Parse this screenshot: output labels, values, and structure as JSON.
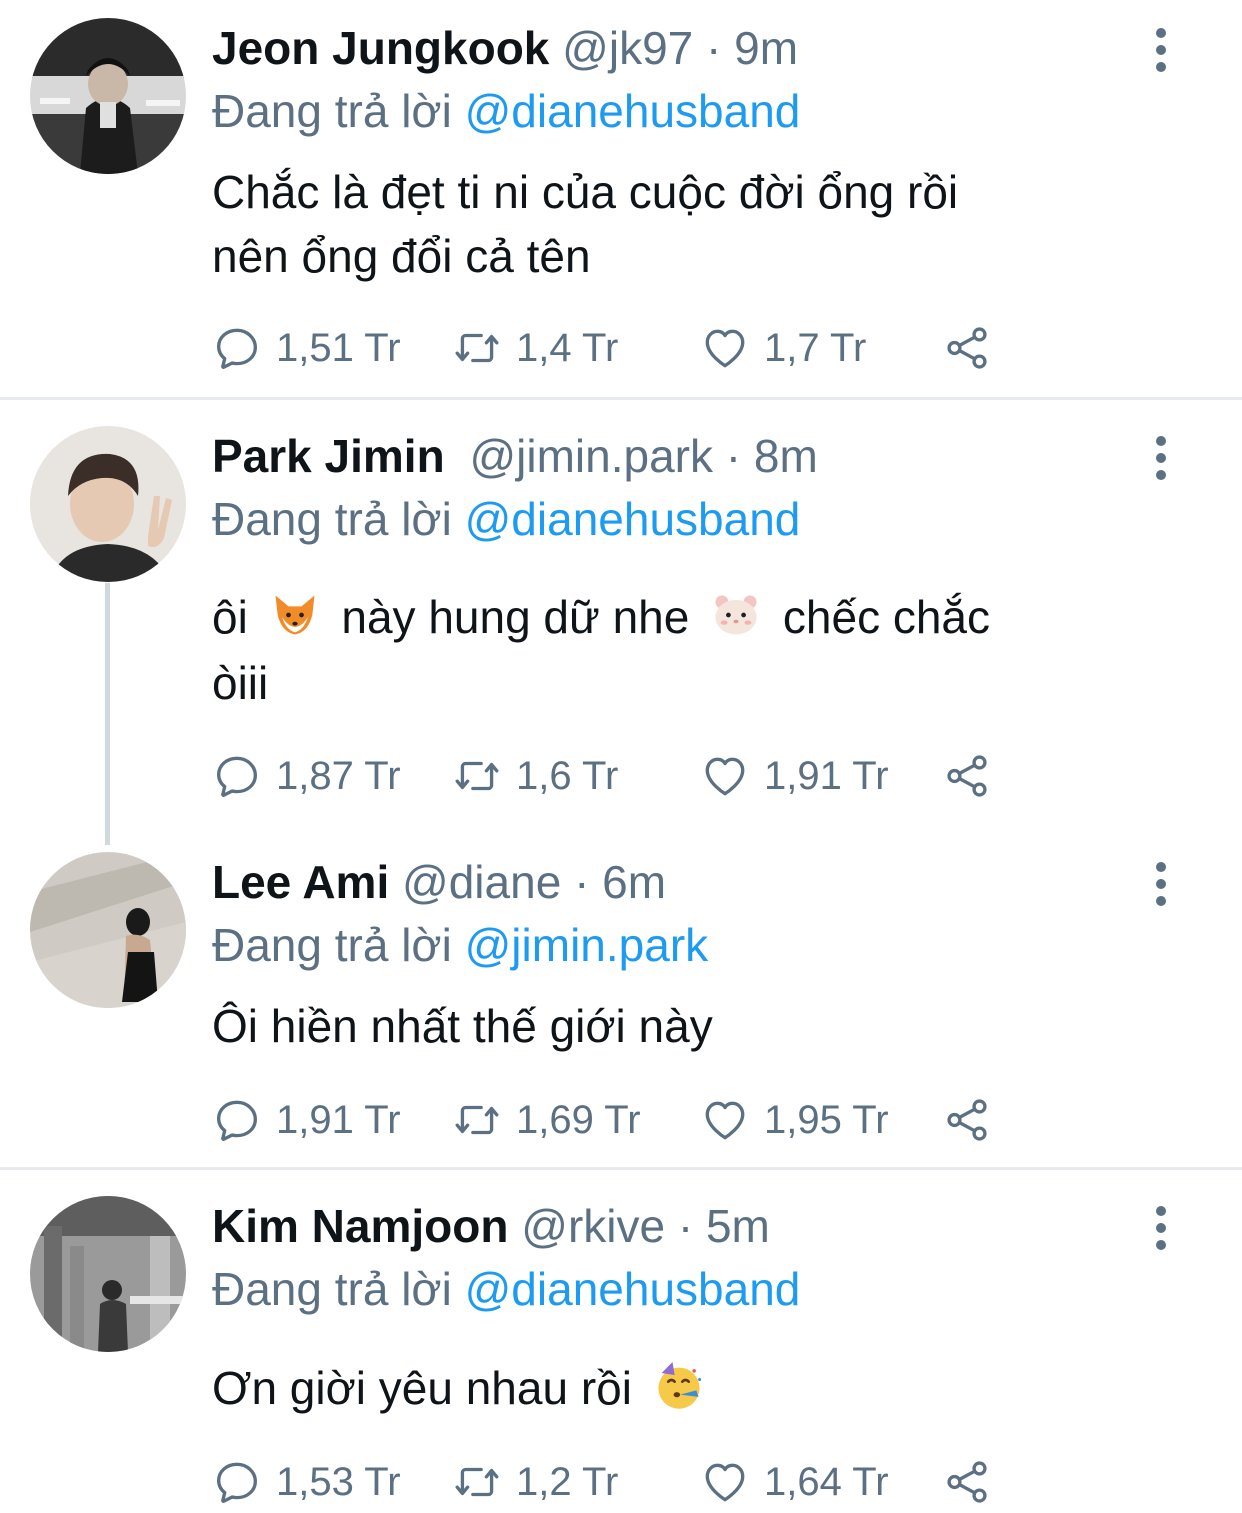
{
  "reply_prefix": "Đang trả lời",
  "colors": {
    "name": "#0f1419",
    "secondary": "#5b7083",
    "link": "#1d9bf0",
    "divider": "#e7eaed",
    "thread_line": "#cfd9de"
  },
  "tweets": [
    {
      "display_name": "Jeon Jungkook",
      "handle": "@jk97",
      "separator": "·",
      "time": "9m",
      "reply_to": "@dianehusband",
      "text_lines": [
        "Chắc là đẹt ti ni của cuộc đời ổng rồi",
        "nên ổng đổi cả tên"
      ],
      "stats": {
        "replies": "1,51 Tr",
        "retweets": "1,4 Tr",
        "likes": "1,7 Tr"
      },
      "icons": [
        "reply-icon",
        "retweet-icon",
        "heart-icon",
        "share-icon"
      ]
    },
    {
      "display_name": "Park Jimin",
      "handle": "@jimin.park",
      "separator": "·",
      "time": "8m",
      "reply_to": "@dianehusband",
      "text_parts": [
        "ôi",
        "này hung dữ nhe",
        "chếc chắc"
      ],
      "text_line2": "òiii",
      "emojis": [
        "fox-emoji",
        "hamster-emoji"
      ],
      "stats": {
        "replies": "1,87 Tr",
        "retweets": "1,6 Tr",
        "likes": "1,91 Tr"
      }
    },
    {
      "display_name": "Lee Ami",
      "handle": "@diane",
      "separator": "·",
      "time": "6m",
      "reply_to": "@jimin.park",
      "text": "Ôi hiền nhất thế giới này",
      "stats": {
        "replies": "1,91 Tr",
        "retweets": "1,69 Tr",
        "likes": "1,95 Tr"
      }
    },
    {
      "display_name": "Kim Namjoon",
      "handle": "@rkive",
      "separator": "·",
      "time": "5m",
      "reply_to": "@dianehusband",
      "text": "Ơn giời yêu nhau rồi",
      "emojis": [
        "party-face-emoji"
      ],
      "stats": {
        "replies": "1,53 Tr",
        "retweets": "1,2 Tr",
        "likes": "1,64 Tr"
      }
    }
  ]
}
